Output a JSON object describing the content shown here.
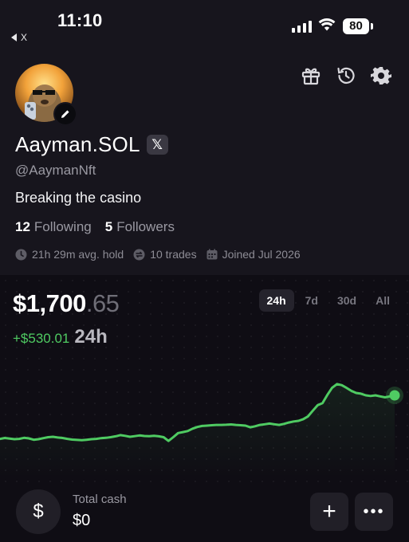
{
  "status_bar": {
    "time": "11:10",
    "back_label": "X",
    "battery": "80"
  },
  "header_icons": [
    "gift-icon",
    "history-icon",
    "gear-icon"
  ],
  "profile": {
    "name": "Aayman.SOL",
    "x_badge": "𝕏",
    "handle": "@AaymanNft",
    "bio": "Breaking the casino",
    "following_count": "12",
    "following_label": "Following",
    "followers_count": "5",
    "followers_label": "Followers",
    "avg_hold": "21h 29m avg. hold",
    "trades": "10 trades",
    "joined": "Joined Jul 2026"
  },
  "portfolio": {
    "balance_main": "$1,700",
    "balance_cents": ".65",
    "change_value": "+$530.01",
    "change_period": "24h",
    "ranges": [
      {
        "label": "24h",
        "active": true
      },
      {
        "label": "7d",
        "active": false
      },
      {
        "label": "30d",
        "active": false
      },
      {
        "label": "All",
        "active": false
      }
    ],
    "line_color": "#4fcb62"
  },
  "cash": {
    "icon_symbol": "$",
    "label": "Total cash",
    "value": "$0"
  },
  "actions": {
    "plus_symbol": "+",
    "more_symbol": "•••"
  },
  "chart_data": {
    "type": "line",
    "title": "",
    "xlabel": "",
    "ylabel": "",
    "x": [
      0,
      6,
      12,
      18,
      24,
      30,
      36,
      42,
      48,
      54,
      60,
      66,
      72,
      78,
      84,
      90,
      96,
      102,
      108,
      114,
      120,
      126,
      132,
      138,
      144,
      150,
      156,
      162,
      168,
      174,
      180,
      186,
      192,
      198,
      204,
      210,
      216,
      222,
      228,
      234,
      240,
      246,
      252,
      258,
      264,
      270,
      276,
      282,
      288,
      294,
      300,
      306,
      312,
      318,
      324,
      330,
      336,
      342,
      348,
      354,
      360,
      366,
      372,
      378,
      384,
      390,
      396,
      402,
      408,
      414,
      420,
      426,
      432,
      438,
      444,
      450,
      456,
      462,
      468,
      474,
      480,
      486,
      492
    ],
    "series": [
      {
        "values": [
          1180,
          1185,
          1182,
          1178,
          1180,
          1186,
          1183,
          1175,
          1178,
          1184,
          1190,
          1192,
          1188,
          1185,
          1180,
          1176,
          1174,
          1172,
          1175,
          1178,
          1180,
          1184,
          1186,
          1190,
          1195,
          1202,
          1198,
          1192,
          1196,
          1200,
          1197,
          1196,
          1198,
          1195,
          1190,
          1168,
          1190,
          1214,
          1220,
          1226,
          1240,
          1250,
          1256,
          1258,
          1260,
          1262,
          1262,
          1263,
          1265,
          1262,
          1260,
          1258,
          1248,
          1254,
          1262,
          1266,
          1270,
          1266,
          1262,
          1268,
          1276,
          1282,
          1286,
          1296,
          1312,
          1346,
          1378,
          1390,
          1438,
          1480,
          1502,
          1496,
          1480,
          1462,
          1450,
          1446,
          1436,
          1432,
          1436,
          1430,
          1424,
          1430,
          1436
        ]
      }
    ],
    "ylim": [
      1000,
      1600
    ],
    "grid": false,
    "legend": "none",
    "end_marker": true
  }
}
